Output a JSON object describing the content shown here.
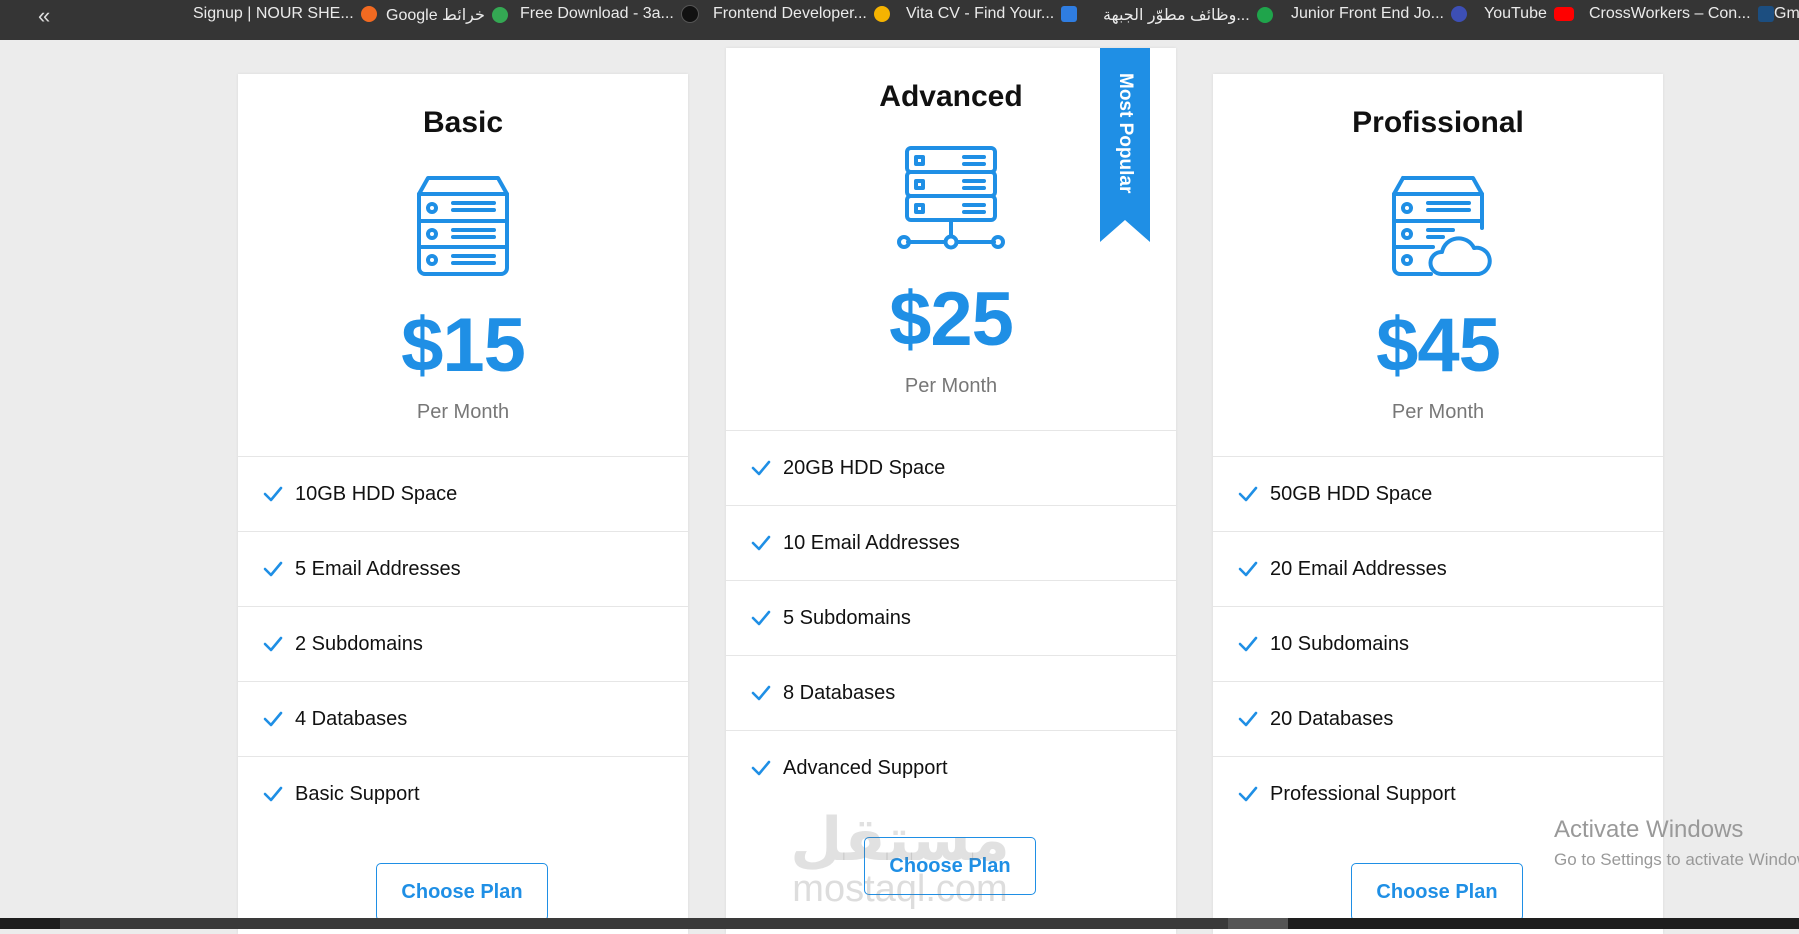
{
  "bookmarks": {
    "collapse": "«",
    "items": [
      {
        "label": "Signup | NOUR SHE...",
        "color": "#f26a21"
      },
      {
        "label": "Google خرائط",
        "color": "#34a853"
      },
      {
        "label": "Free Download - 3a...",
        "color": "#111111"
      },
      {
        "label": "Frontend Developer...",
        "color": "#f5b301"
      },
      {
        "label": "Vita CV - Find Your...",
        "color": "#2f7de1"
      },
      {
        "label": "وظائف مطوّر الجبهة...",
        "color": "#1fa44b"
      },
      {
        "label": "Junior Front End Jo...",
        "color": "#3d4fb5"
      },
      {
        "label": "YouTube",
        "color": "#ff0000"
      },
      {
        "label": "CrossWorkers – Con...",
        "color": "#1c4e80"
      },
      {
        "label": "Gm",
        "color": "#ea4335"
      }
    ]
  },
  "plans": [
    {
      "title": "Basic",
      "icon": "server-stack-icon",
      "price": "$15",
      "period": "Per Month",
      "features": [
        "10GB HDD Space",
        "5 Email Addresses",
        "2 Subdomains",
        "4 Databases",
        "Basic Support"
      ],
      "button": "Choose Plan"
    },
    {
      "title": "Advanced",
      "icon": "server-network-icon",
      "price": "$25",
      "period": "Per Month",
      "features": [
        "20GB HDD Space",
        "10 Email Addresses",
        "5 Subdomains",
        "8 Databases",
        "Advanced Support"
      ],
      "button": "Choose Plan",
      "badge": "Most Popular"
    },
    {
      "title": "Profissional",
      "icon": "server-cloud-icon",
      "price": "$45",
      "period": "Per Month",
      "features": [
        "50GB HDD Space",
        "20 Email Addresses",
        "10 Subdomains",
        "20 Databases",
        "Professional Support"
      ],
      "button": "Choose Plan"
    }
  ],
  "watermark": {
    "logo": "مستقل",
    "url": "mostaql.com"
  },
  "activate_windows": {
    "title": "Activate Windows",
    "subtitle": "Go to Settings to activate Windows."
  },
  "colors": {
    "accent": "#1f8fe5",
    "background": "#ececec",
    "bookmarks_bar": "#353535"
  }
}
